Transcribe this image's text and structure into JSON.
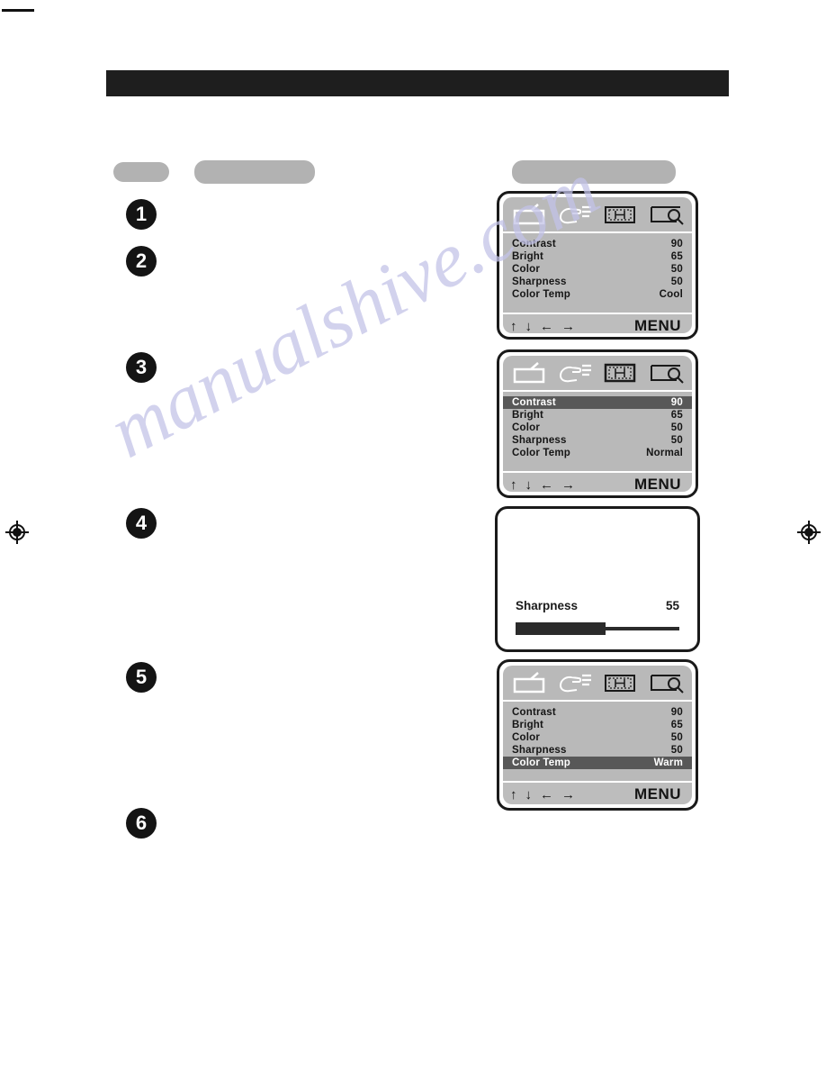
{
  "page": {
    "watermark": "manualshive.com",
    "background_color": "#ffffff"
  },
  "marks": {
    "crop_line": "crop-mark-line",
    "registration_left": "registration-crosshair",
    "registration_right": "registration-crosshair"
  },
  "redactions": {
    "black_banner": "",
    "pill_a": "",
    "pill_b": "",
    "pill_c": ""
  },
  "steps": [
    {
      "number": "1"
    },
    {
      "number": "2"
    },
    {
      "number": "3"
    },
    {
      "number": "4"
    },
    {
      "number": "5"
    },
    {
      "number": "6"
    }
  ],
  "osd_icons": [
    {
      "name": "tv-picture-icon",
      "label": "picture"
    },
    {
      "name": "hand-sound-icon",
      "label": "sound"
    },
    {
      "name": "screen-position-icon",
      "label": "position"
    },
    {
      "name": "screen-zoom-icon",
      "label": "setup"
    }
  ],
  "nav": {
    "up_arrow": "↑",
    "down_arrow": "↓",
    "left_arrow": "←",
    "right_arrow": "→",
    "menu_label": "MENU"
  },
  "osd_panels": [
    {
      "id": "osd-picture-cool",
      "active_icon_index": 0,
      "rows": [
        {
          "label": "Contrast",
          "value": "90",
          "highlighted": false
        },
        {
          "label": "Bright",
          "value": "65",
          "highlighted": false
        },
        {
          "label": "Color",
          "value": "50",
          "highlighted": false
        },
        {
          "label": "Sharpness",
          "value": "50",
          "highlighted": false
        },
        {
          "label": "Color Temp",
          "value": "Cool",
          "highlighted": false
        }
      ]
    },
    {
      "id": "osd-picture-contrast-selected",
      "active_icon_index": 2,
      "rows": [
        {
          "label": "Contrast",
          "value": "90",
          "highlighted": true
        },
        {
          "label": "Bright",
          "value": "65",
          "highlighted": false
        },
        {
          "label": "Color",
          "value": "50",
          "highlighted": false
        },
        {
          "label": "Sharpness",
          "value": "50",
          "highlighted": false
        },
        {
          "label": "Color Temp",
          "value": "Normal",
          "highlighted": false
        }
      ]
    },
    {
      "id": "osd-picture-colortemp-warm",
      "active_icon_index": 0,
      "rows": [
        {
          "label": "Contrast",
          "value": "90",
          "highlighted": false
        },
        {
          "label": "Bright",
          "value": "65",
          "highlighted": false
        },
        {
          "label": "Color",
          "value": "50",
          "highlighted": false
        },
        {
          "label": "Sharpness",
          "value": "50",
          "highlighted": false
        },
        {
          "label": "Color Temp",
          "value": "Warm",
          "highlighted": true
        }
      ]
    }
  ],
  "sharpness_popup": {
    "label": "Sharpness",
    "value": "55",
    "fill_percent": 55
  }
}
